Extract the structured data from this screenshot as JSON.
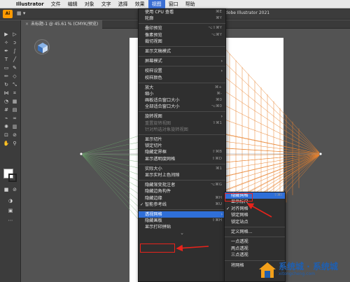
{
  "menubar": {
    "items": [
      "Illustrator",
      "文件",
      "编辑",
      "对象",
      "文字",
      "选择",
      "效果",
      "视图",
      "窗口",
      "帮助"
    ],
    "active_index": 7
  },
  "app": {
    "logo": "Ai",
    "doc_title": "dobe Illustrator 2021"
  },
  "document_tab": {
    "label": "未标题-1 @ 45.61 % (CMYK/预览)"
  },
  "view_menu": [
    {
      "label": "使用 CPU 查看",
      "shortcut": "⌘E"
    },
    {
      "label": "轮廓",
      "shortcut": "⌘Y"
    },
    {
      "sep": true
    },
    {
      "label": "叠印预览",
      "shortcut": "⌥⇧⌘Y"
    },
    {
      "label": "像素预览",
      "shortcut": "⌥⌘Y"
    },
    {
      "label": "裁切视图",
      "shortcut": ""
    },
    {
      "sep": true
    },
    {
      "label": "显示文稿模式",
      "shortcut": ""
    },
    {
      "sep": true
    },
    {
      "label": "屏幕模式",
      "shortcut": "",
      "submenu": true
    },
    {
      "sep": true
    },
    {
      "label": "校样设置",
      "shortcut": "",
      "submenu": true
    },
    {
      "label": "校样颜色",
      "shortcut": ""
    },
    {
      "sep": true
    },
    {
      "label": "放大",
      "shortcut": "⌘+"
    },
    {
      "label": "缩小",
      "shortcut": "⌘-"
    },
    {
      "label": "画板适合窗口大小",
      "shortcut": "⌘0"
    },
    {
      "label": "全部适合窗口大小",
      "shortcut": "⌥⌘0"
    },
    {
      "sep": true
    },
    {
      "label": "旋转视图",
      "shortcut": "",
      "submenu": true
    },
    {
      "label": "重置旋转视图",
      "shortcut": "⇧⌘1",
      "dim": true
    },
    {
      "label": "针对所选对象旋转视图",
      "shortcut": "",
      "dim": true
    },
    {
      "sep": true
    },
    {
      "label": "显示切片",
      "shortcut": ""
    },
    {
      "label": "锁定切片",
      "shortcut": ""
    },
    {
      "label": "隐藏定界框",
      "shortcut": "⇧⌘B"
    },
    {
      "label": "显示透明度网格",
      "shortcut": "⇧⌘D"
    },
    {
      "sep": true
    },
    {
      "label": "实际大小",
      "shortcut": "⌘1"
    },
    {
      "label": "显示实时上色间隙",
      "shortcut": ""
    },
    {
      "sep": true
    },
    {
      "label": "隐藏渐变批注者",
      "shortcut": "⌥⌘G"
    },
    {
      "label": "隐藏边角构件",
      "shortcut": ""
    },
    {
      "label": "隐藏边缘",
      "shortcut": "⌘H"
    },
    {
      "label": "智能参考线",
      "shortcut": "⌘U",
      "checked": true
    },
    {
      "sep": true
    },
    {
      "label": "透视网格",
      "shortcut": "",
      "submenu": true,
      "selected": true
    },
    {
      "label": "隐藏画板",
      "shortcut": "⇧⌘H"
    },
    {
      "label": "显示打印拼贴",
      "shortcut": ""
    }
  ],
  "perspective_submenu": [
    {
      "label": "隐藏网格",
      "shortcut": "⇧⌘I",
      "highlight": true
    },
    {
      "label": "显示标尺",
      "shortcut": ""
    },
    {
      "label": "对齐网格",
      "shortcut": "",
      "checked": true
    },
    {
      "label": "锁定网格",
      "shortcut": ""
    },
    {
      "label": "锁定站点",
      "shortcut": ""
    },
    {
      "sep": true
    },
    {
      "label": "定义网格...",
      "shortcut": ""
    },
    {
      "sep": true
    },
    {
      "label": "一点透视",
      "shortcut": ""
    },
    {
      "label": "两点透视",
      "shortcut": ""
    },
    {
      "label": "三点透视",
      "shortcut": ""
    },
    {
      "sep": true
    },
    {
      "label": "将网格",
      "shortcut": ""
    }
  ],
  "menu_more_glyph": "⌄",
  "watermark": {
    "title": "系统城 · 系统城",
    "url": "xitongcheng.com"
  },
  "colors": {
    "accent": "#2f6fd8",
    "annotation": "#e8231b",
    "grid_right": "#e8822e",
    "grid_left": "#6aa66a"
  }
}
